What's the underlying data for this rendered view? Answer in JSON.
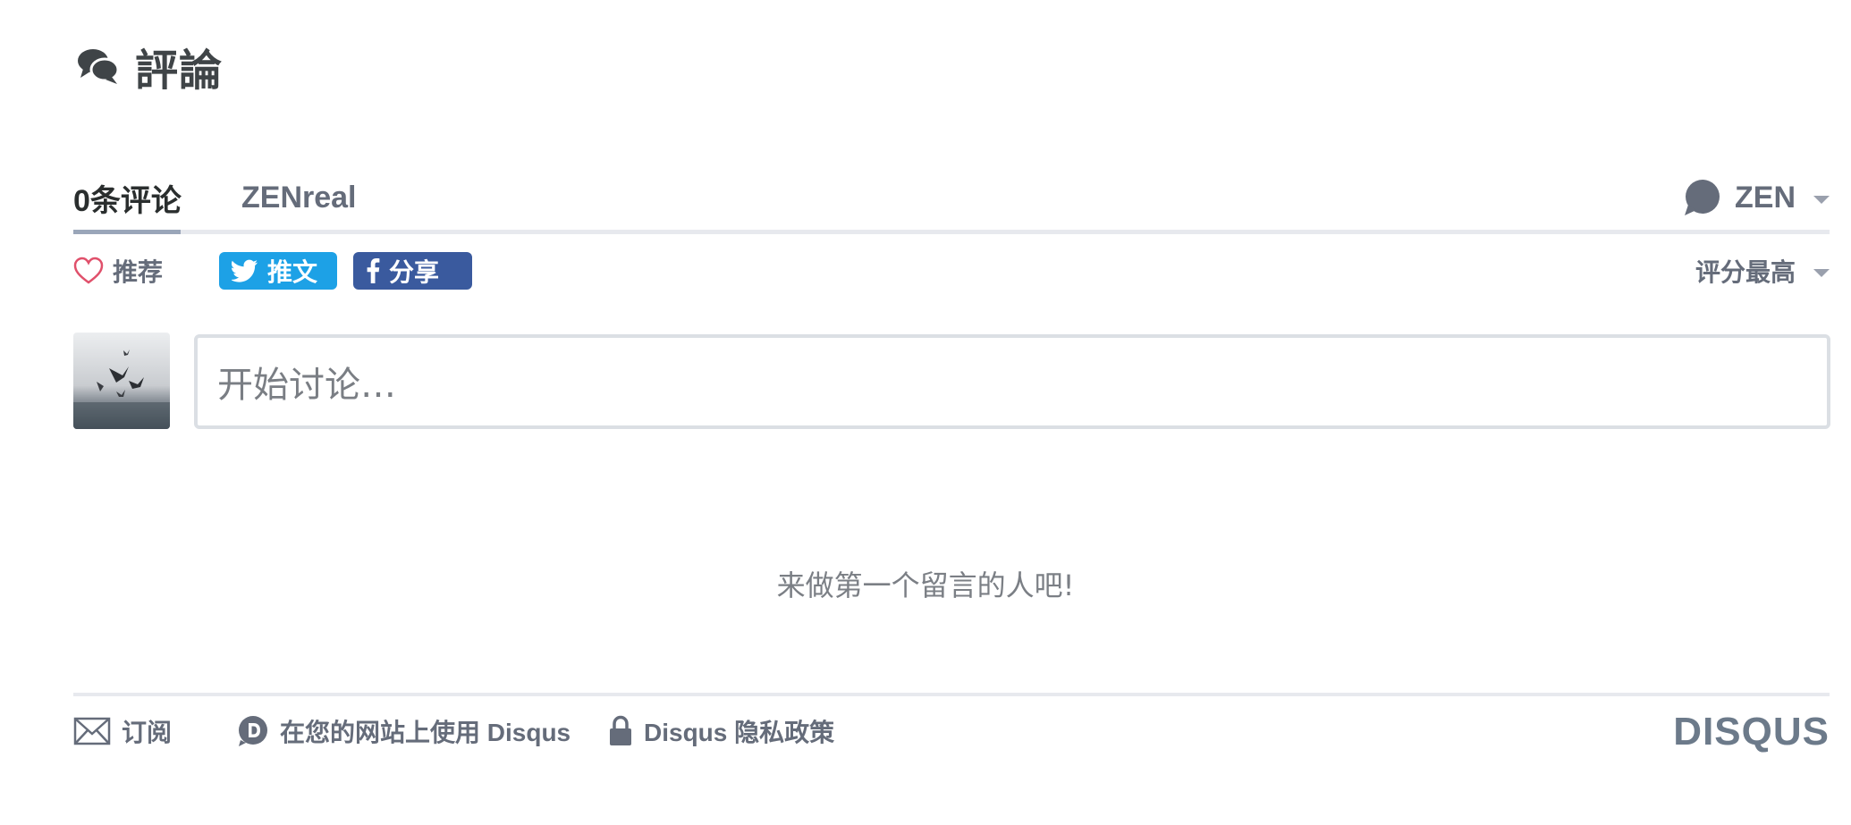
{
  "header": {
    "title": "評論",
    "icon": "comments-icon"
  },
  "tabs": {
    "comments_label": "0条评论",
    "community_label": "ZENreal",
    "user_label": "ZEN"
  },
  "actions": {
    "recommend_label": "推荐",
    "tweet_label": "推文",
    "share_label": "分享",
    "sort_label": "评分最高"
  },
  "composer": {
    "placeholder": "开始讨论…"
  },
  "empty_state": {
    "message": "来做第一个留言的人吧!"
  },
  "footer": {
    "subscribe_label": "订阅",
    "add_disqus_label": "在您的网站上使用 Disqus",
    "privacy_label": "Disqus 隐私政策",
    "brand": "DISQUS"
  },
  "colors": {
    "twitter": "#1da1e6",
    "facebook": "#3a5a9e",
    "recommend_heart": "#e0506b",
    "text": "#656c7a",
    "tab_active_underline": "#9aa6b9"
  }
}
